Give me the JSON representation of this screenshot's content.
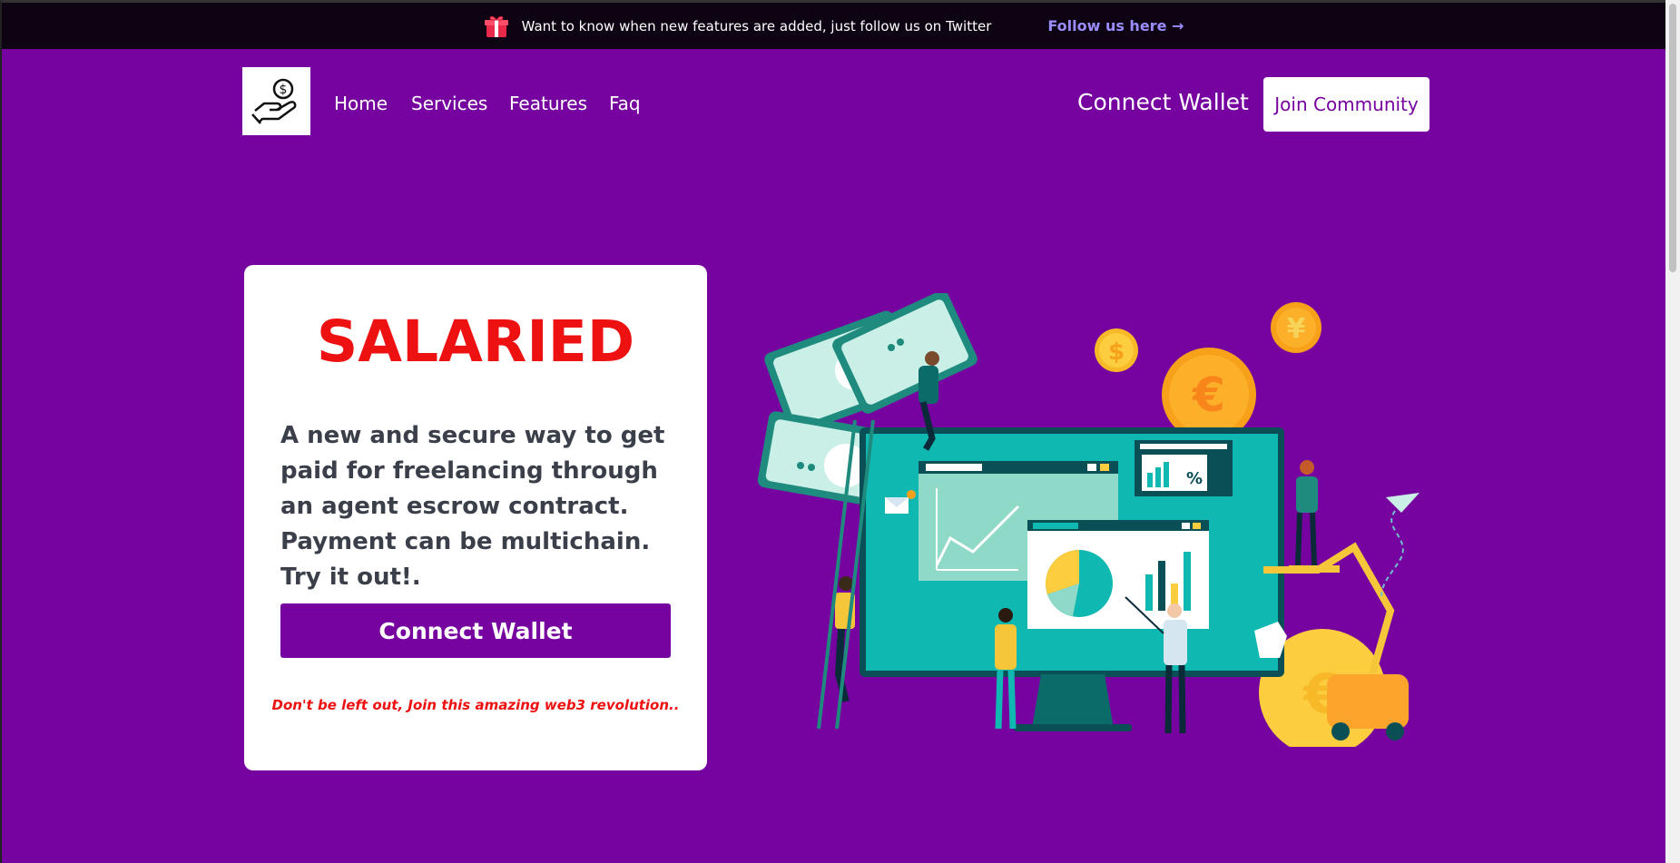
{
  "announcement": {
    "text": "Want to know when new features are added, just follow us on Twitter",
    "link_label": "Follow us here →"
  },
  "nav": {
    "items": [
      {
        "label": "Home"
      },
      {
        "label": "Services"
      },
      {
        "label": "Features"
      },
      {
        "label": "Faq"
      }
    ],
    "connect_label": "Connect Wallet",
    "join_label": "Join Community"
  },
  "hero": {
    "brand": "SALARIED",
    "lead": "A new and secure way to get paid for freelancing through an agent escrow contract. Payment can be multichain. Try it out!.",
    "cta_label": "Connect Wallet",
    "tagline": "Don't be left out, Join this amazing web3 revolution.."
  },
  "colors": {
    "background": "#76039f",
    "brand": "#ee1111",
    "announcement_bg": "#0d0312",
    "link": "#9b8cff"
  },
  "icons": {
    "logo": "hand-holding-dollar-icon",
    "gift": "gift-icon",
    "arrow": "arrow-right-icon"
  }
}
